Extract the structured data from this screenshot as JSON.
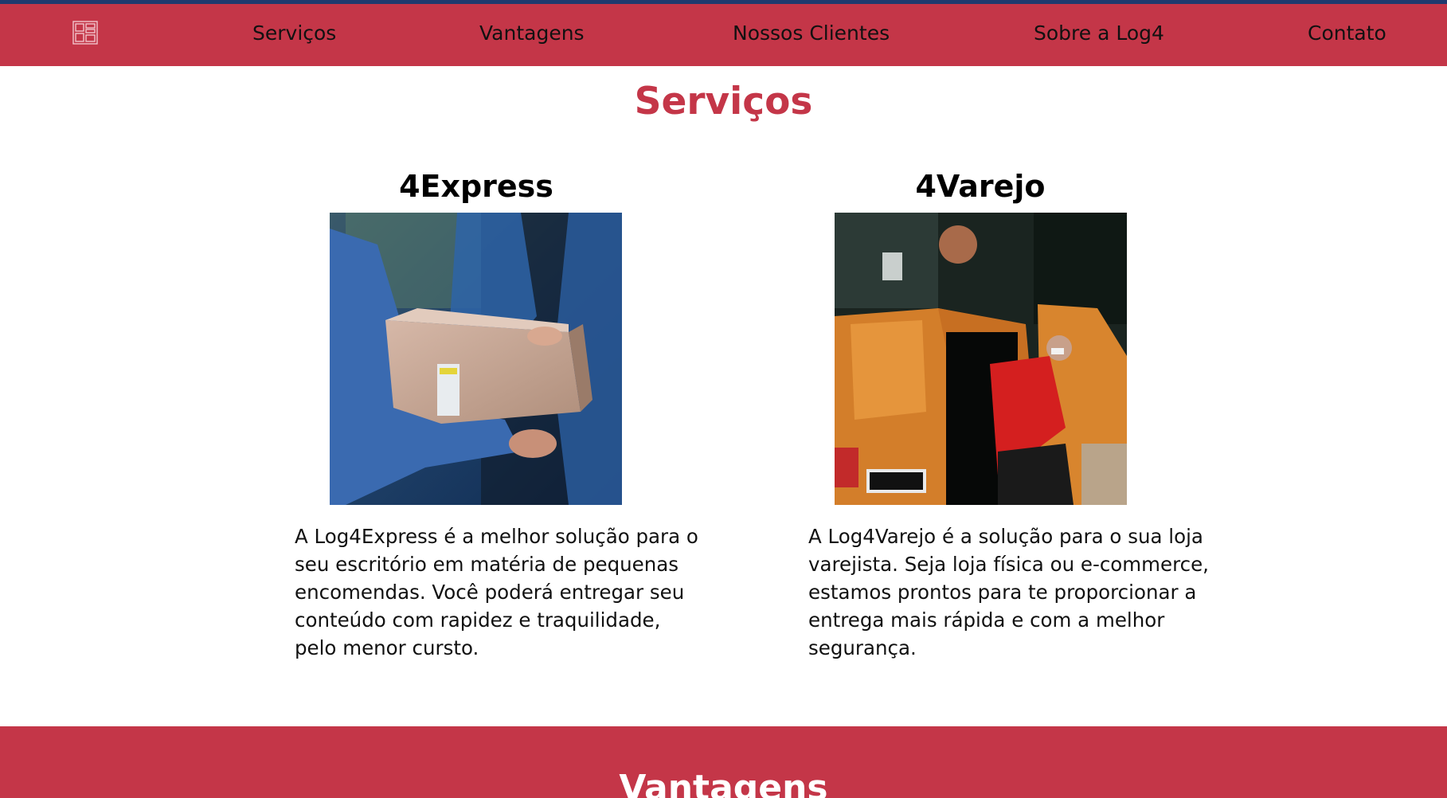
{
  "nav": {
    "logo_icon": "grid-logo-icon",
    "items": [
      {
        "label": "Serviços"
      },
      {
        "label": "Vantagens"
      },
      {
        "label": "Nossos Clientes"
      },
      {
        "label": "Sobre a Log4"
      },
      {
        "label": "Contato"
      }
    ]
  },
  "colors": {
    "brand": "#c43648",
    "stripe": "#1f3a6e",
    "text": "#111111",
    "band_text": "#ffffff"
  },
  "services": {
    "title": "Serviços",
    "cards": [
      {
        "title": "4Express",
        "image": "package-handover-photo",
        "description": "A Log4Express é a melhor solução para o seu escritório em matéria de pequenas encomendas. Você poderá entregar seu conteúdo com rapidez e traquilidade, pelo menor cursto."
      },
      {
        "title": "4Varejo",
        "image": "delivery-van-photo",
        "description": "A Log4Varejo é a solução para o sua loja varejista. Seja loja física ou e-commerce, estamos prontos para te proporcionar a entrega mais rápida e com a melhor segurança."
      }
    ]
  },
  "advantages": {
    "title": "Vantagens"
  }
}
